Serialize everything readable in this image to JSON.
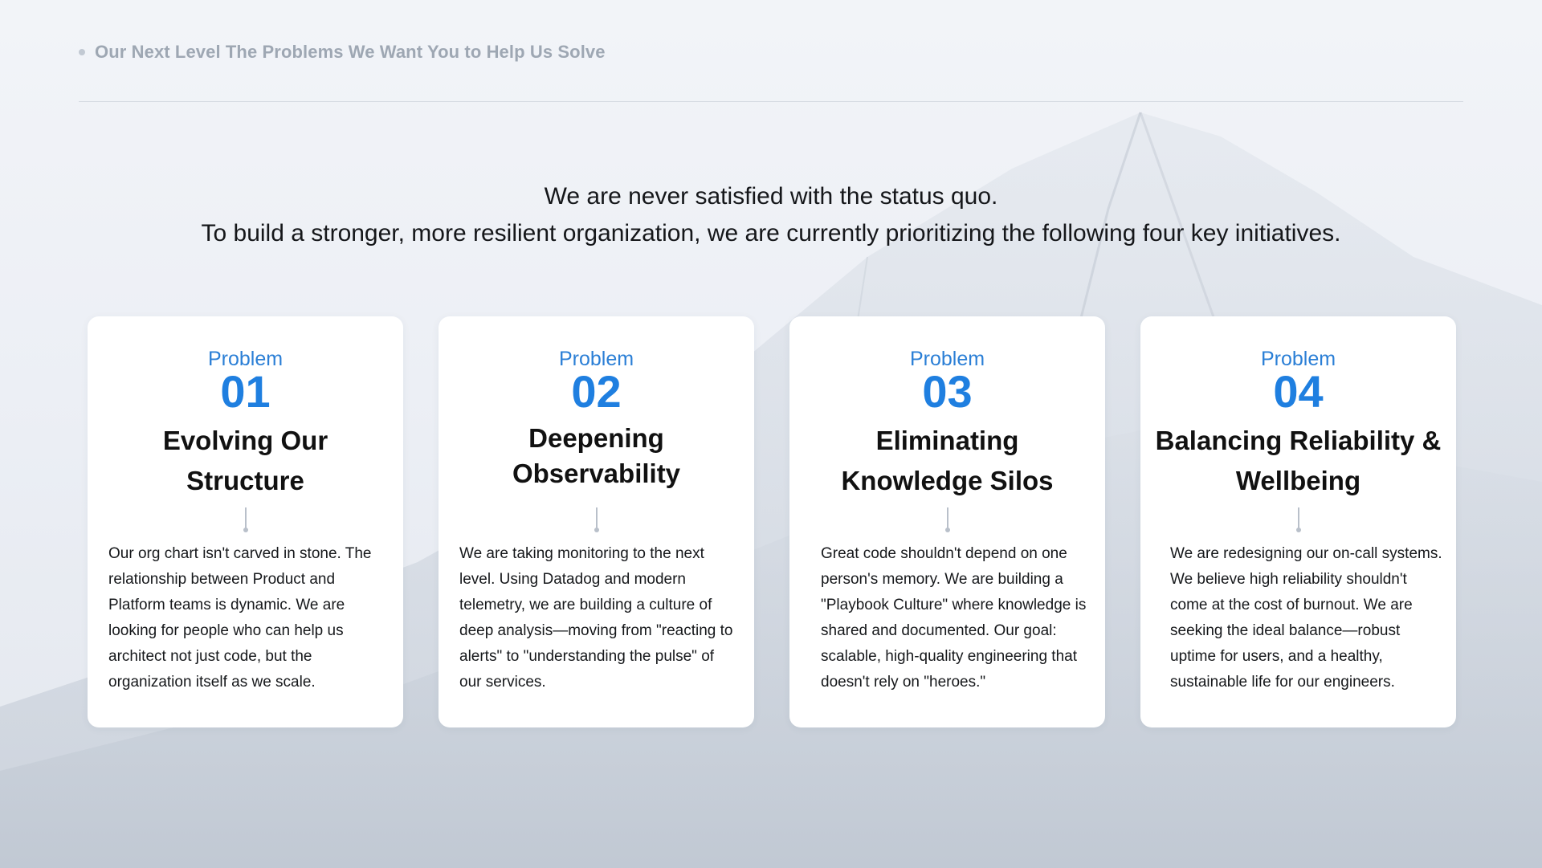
{
  "header": {
    "title": "Our Next Level The Problems We Want You to Help Us Solve"
  },
  "intro": {
    "line1": "We are never satisfied with the status quo.",
    "line2": "To build a stronger, more resilient organization, we are currently prioritizing the following four key initiatives."
  },
  "cards": [
    {
      "label": "Problem",
      "number": "01",
      "title": "Evolving Our Structure",
      "body": "Our org chart isn't carved in stone. The relationship between Product and Platform teams is dynamic. We are looking for people who can help us architect not just code, but the organization itself as we scale."
    },
    {
      "label": "Problem",
      "number": "02",
      "title": "Deepening Observability",
      "body": "We are taking monitoring to the next level. Using Datadog and modern telemetry, we are building a culture of deep analysis—moving from \"reacting to alerts\" to \"understanding the pulse\" of our services."
    },
    {
      "label": "Problem",
      "number": "03",
      "title": "Eliminating Knowledge Silos",
      "body": "Great code shouldn't depend on one person's memory. We are building a \"Playbook Culture\" where knowledge is shared and documented. Our goal: scalable, high-quality engineering that doesn't rely on \"heroes.\""
    },
    {
      "label": "Problem",
      "number": "04",
      "title": "Balancing Reliability & Wellbeing",
      "body": "We are redesigning our on-call systems. We believe high reliability shouldn't come at the cost of burnout. We are seeking the ideal balance—robust uptime for users, and a healthy, sustainable life for our engineers."
    }
  ],
  "colors": {
    "accent": "#1f7fe0",
    "header_text": "#9ea7b3",
    "card_background": "#ffffff"
  }
}
